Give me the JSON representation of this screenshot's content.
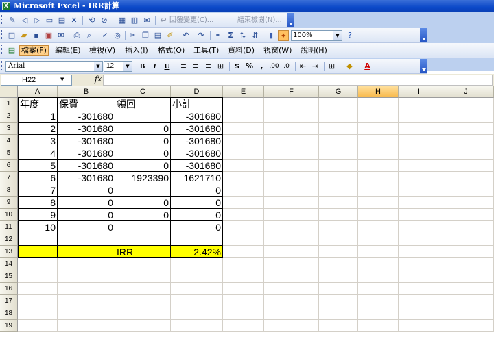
{
  "window": {
    "title": "Microsoft Excel - IRR計算",
    "app_icon": "excel-icon"
  },
  "reviewing_toolbar": {
    "reply_label": "回覆變更(C)...",
    "end_review_label": "結束檢閱(N)..."
  },
  "standard_toolbar": {
    "zoom_value": "100%"
  },
  "menu": {
    "items": [
      {
        "label": "檔案(F)",
        "active": true
      },
      {
        "label": "編輯(E)"
      },
      {
        "label": "檢視(V)"
      },
      {
        "label": "插入(I)"
      },
      {
        "label": "格式(O)"
      },
      {
        "label": "工具(T)"
      },
      {
        "label": "資料(D)"
      },
      {
        "label": "視窗(W)"
      },
      {
        "label": "說明(H)"
      }
    ]
  },
  "formatting_toolbar": {
    "font": "Arial",
    "size": "12",
    "bold": "B",
    "italic": "I",
    "underline": "U",
    "currency": "$",
    "percent": "%",
    "comma": ","
  },
  "formula_bar": {
    "name_box": "H22",
    "fx_label": "fx",
    "formula": ""
  },
  "sheet": {
    "columns": [
      "A",
      "B",
      "C",
      "D",
      "E",
      "F",
      "G",
      "H",
      "I",
      "J"
    ],
    "selected_column": "H",
    "rows": [
      "1",
      "2",
      "3",
      "4",
      "5",
      "6",
      "7",
      "8",
      "9",
      "10",
      "11",
      "12",
      "13",
      "14",
      "15",
      "16",
      "17",
      "18",
      "19"
    ],
    "headers": [
      "年度",
      "保費",
      "領回",
      "小計"
    ],
    "data": [
      [
        "1",
        "-301680",
        "",
        "-301680"
      ],
      [
        "2",
        "-301680",
        "0",
        "-301680"
      ],
      [
        "3",
        "-301680",
        "0",
        "-301680"
      ],
      [
        "4",
        "-301680",
        "0",
        "-301680"
      ],
      [
        "5",
        "-301680",
        "0",
        "-301680"
      ],
      [
        "6",
        "-301680",
        "1923390",
        "1621710"
      ],
      [
        "7",
        "0",
        "",
        "0"
      ],
      [
        "8",
        "0",
        "0",
        "0"
      ],
      [
        "9",
        "0",
        "0",
        "0"
      ],
      [
        "10",
        "0",
        "",
        "0"
      ],
      [
        "",
        "",
        "",
        ""
      ]
    ],
    "irr_row": {
      "label": "IRR",
      "value": "2.42%"
    },
    "highlight_color": "#ffff00"
  }
}
